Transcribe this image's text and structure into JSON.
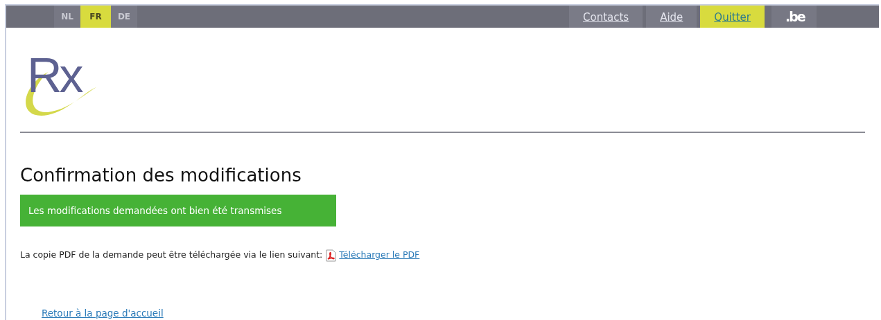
{
  "languages": [
    {
      "label": "NL",
      "selected": false
    },
    {
      "label": "FR",
      "selected": true
    },
    {
      "label": "DE",
      "selected": false
    }
  ],
  "top_links": [
    {
      "label": "Contacts",
      "selected": false
    },
    {
      "label": "Aide",
      "selected": false
    },
    {
      "label": "Quitter",
      "selected": true
    }
  ],
  "brand": ".be",
  "logo": "Rx",
  "heading": "Confirmation des modifications",
  "success_message": "Les modifications demandées ont bien été transmises",
  "download_text": "La copie PDF de la demande peut être téléchargée via le lien suivant:",
  "download_link": "Télécharger le PDF",
  "home_link": "Retour à la page d'accueil"
}
